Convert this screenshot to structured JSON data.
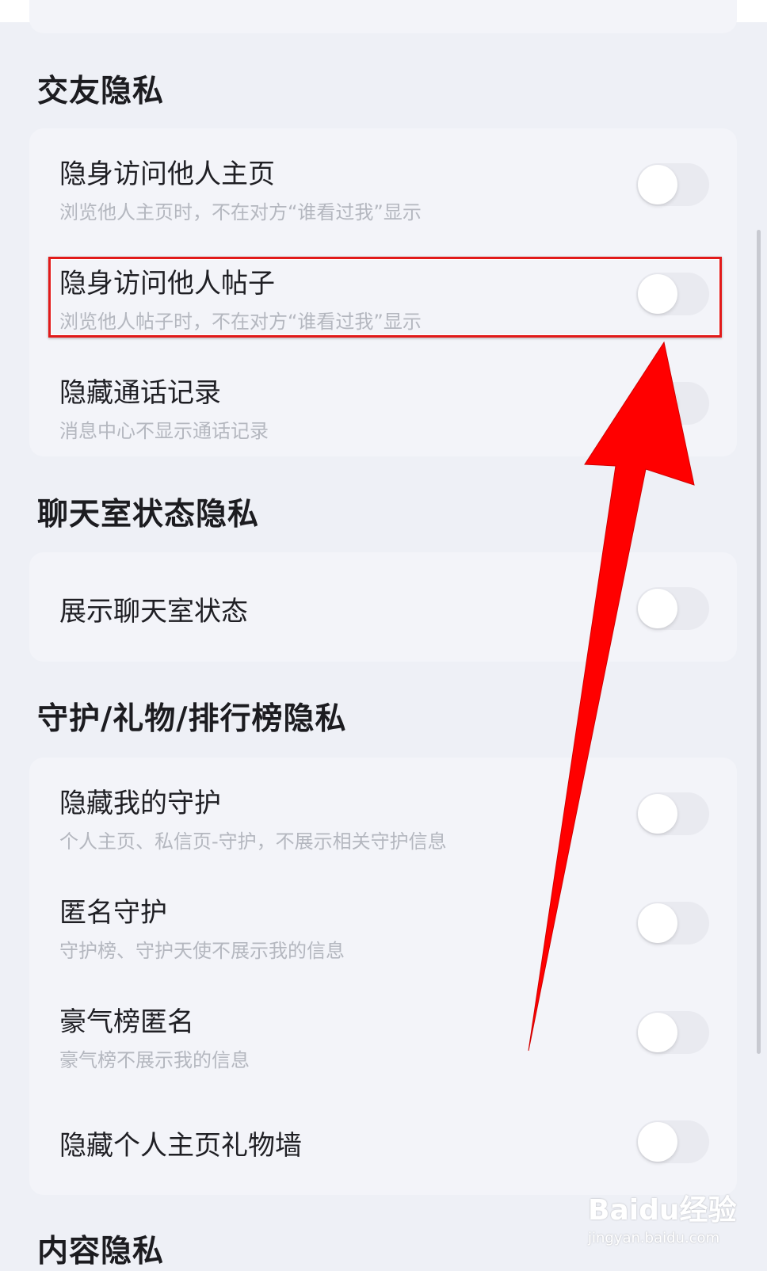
{
  "sections": [
    {
      "title": "交友隐私",
      "items": [
        {
          "label": "隐身访问他人主页",
          "desc": "浏览他人主页时，不在对方“谁看过我”显示",
          "enabled": false
        },
        {
          "label": "隐身访问他人帖子",
          "desc": "浏览他人帖子时，不在对方“谁看过我”显示",
          "enabled": false
        },
        {
          "label": "隐藏通话记录",
          "desc": "消息中心不显示通话记录",
          "enabled": false
        }
      ]
    },
    {
      "title": "聊天室状态隐私",
      "items": [
        {
          "label": "展示聊天室状态",
          "enabled": false
        }
      ]
    },
    {
      "title": "守护/礼物/排行榜隐私",
      "items": [
        {
          "label": "隐藏我的守护",
          "desc": "个人主页、私信页-守护，不展示相关守护信息",
          "enabled": false
        },
        {
          "label": "匿名守护",
          "desc": "守护榜、守护天使不展示我的信息",
          "enabled": false
        },
        {
          "label": "豪气榜匿名",
          "desc": "豪气榜不展示我的信息",
          "enabled": false
        },
        {
          "label": "隐藏个人主页礼物墙",
          "enabled": false
        }
      ]
    },
    {
      "title": "内容隐私"
    }
  ],
  "watermark": {
    "brand": "Baidu经验",
    "url": "jingyan.baidu.com"
  },
  "colors": {
    "page_bg": "#eef0f6",
    "card_bg": "#f3f4f9",
    "annotation_red": "#e21a1a",
    "toggle_off": "#e9eaf0"
  }
}
